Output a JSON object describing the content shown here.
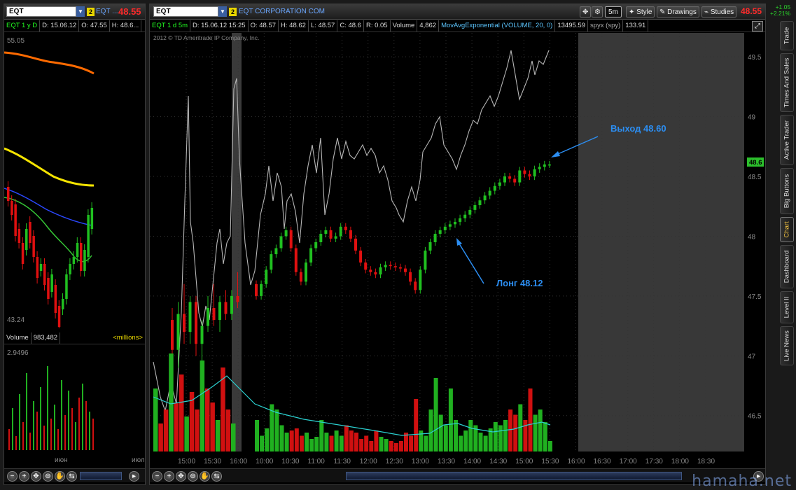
{
  "left": {
    "symbol": "EQT",
    "badge": "2",
    "company": "EQT ...",
    "last_price": "48.55",
    "info": {
      "period": "EQT 1 y D",
      "date": "D: 15.06.12",
      "open": "O: 47.55",
      "high": "H: 48.6..."
    },
    "price_top": "55.05",
    "price_bottom": "43.24",
    "volume_label": "Volume",
    "volume_value": "983,482",
    "volume_units": "<millions>",
    "volume_top": "2.9496",
    "x_labels": [
      "июн",
      "июл"
    ]
  },
  "main": {
    "symbol": "EQT",
    "badge": "2",
    "company": "EQT CORPORATION COM",
    "last_price": "48.55",
    "timeframe": "5m",
    "buttons": {
      "style": "Style",
      "drawings": "Drawings",
      "studies": "Studies"
    },
    "change": "+1.05",
    "change_pct": "+2.21%",
    "copyright": "2012 © TD Ameritrade IP Company, Inc.",
    "info": {
      "period": "EQT 1 d 5m",
      "date": "D: 15.06.12 15:25",
      "open": "O: 48.57",
      "high": "H: 48.62",
      "low": "L: 48.57",
      "close": "C: 48.6",
      "range": "R: 0.05",
      "volume_label": "Volume",
      "volume_value": "4,862",
      "ema": "MovAvgExponential (VOLUME, 20, 0)",
      "ema_value": "13495.59",
      "compare": "spyx (spy)",
      "compare_value": "133.91"
    },
    "price_badge": "48.6",
    "annotations": {
      "exit": "Выход 48.60",
      "long": "Лонг 48.12"
    }
  },
  "side_tabs": [
    "Trade",
    "Times And Sales",
    "Active Trader",
    "Big Buttons",
    "Chart",
    "Dashboard",
    "Level II",
    "Live News"
  ],
  "active_tab": "Chart",
  "watermark": "hamaha.net",
  "chart_data": {
    "type": "candlestick",
    "x_ticks": [
      "15:00",
      "15:30",
      "16:00",
      "10:00",
      "10:30",
      "11:00",
      "11:30",
      "12:00",
      "12:30",
      "13:00",
      "13:30",
      "14:00",
      "14:30",
      "15:00",
      "15:30",
      "16:00",
      "16:30",
      "17:00",
      "17:30",
      "18:00",
      "18:30"
    ],
    "y_ticks": [
      46.5,
      47,
      47.5,
      48,
      48.5,
      49,
      49.5
    ],
    "ylim": [
      46.2,
      49.7
    ],
    "series_today_close": [
      47.5,
      47.6,
      47.72,
      47.85,
      47.9,
      48.0,
      48.05,
      47.9,
      47.7,
      47.62,
      47.78,
      47.9,
      47.95,
      48.02,
      48.05,
      47.98,
      48.0,
      48.08,
      48.05,
      47.98,
      47.88,
      47.78,
      47.72,
      47.7,
      47.68,
      47.74,
      47.76,
      47.75,
      47.74,
      47.73,
      47.7,
      47.62,
      47.55,
      47.72,
      47.88,
      47.95,
      48.02,
      48.05,
      48.08,
      48.1,
      48.12,
      48.15,
      48.18,
      48.22,
      48.26,
      48.3,
      48.34,
      48.38,
      48.42,
      48.45,
      48.5,
      48.48,
      48.45,
      48.55,
      48.52,
      48.5,
      48.56,
      48.58,
      48.6,
      48.6
    ],
    "volume_today": [
      30,
      15,
      22,
      45,
      40,
      25,
      18,
      20,
      22,
      15,
      18,
      12,
      14,
      30,
      18,
      15,
      20,
      15,
      25,
      20,
      18,
      12,
      15,
      10,
      20,
      14,
      12,
      10,
      8,
      10,
      18,
      15,
      50,
      20,
      15,
      40,
      70,
      35,
      25,
      60,
      30,
      15,
      20,
      30,
      25,
      18,
      15,
      22,
      28,
      25,
      30,
      40,
      35,
      45,
      30,
      60,
      35,
      40,
      28,
      10
    ]
  }
}
